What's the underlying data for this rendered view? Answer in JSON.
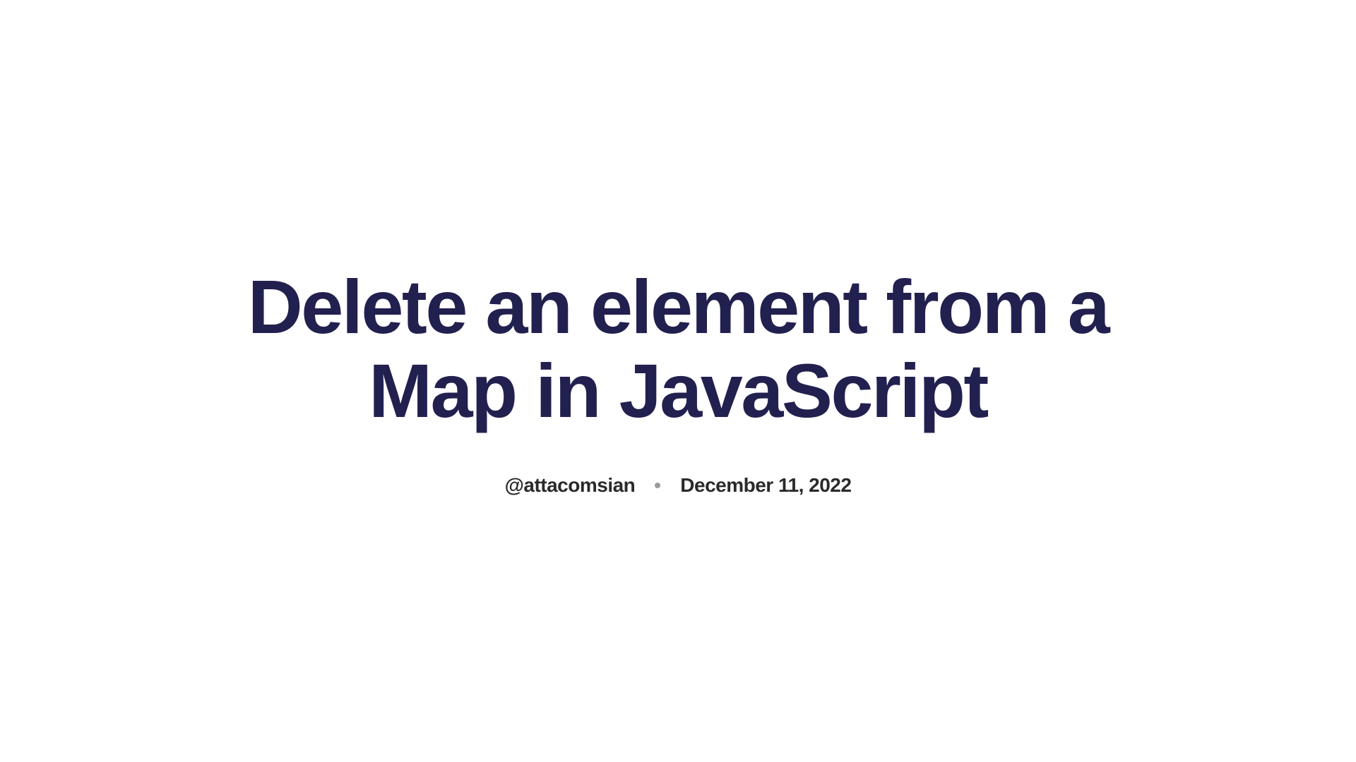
{
  "article": {
    "title": "Delete an element from a Map in JavaScript",
    "author": "@attacomsian",
    "date": "December 11, 2022"
  }
}
